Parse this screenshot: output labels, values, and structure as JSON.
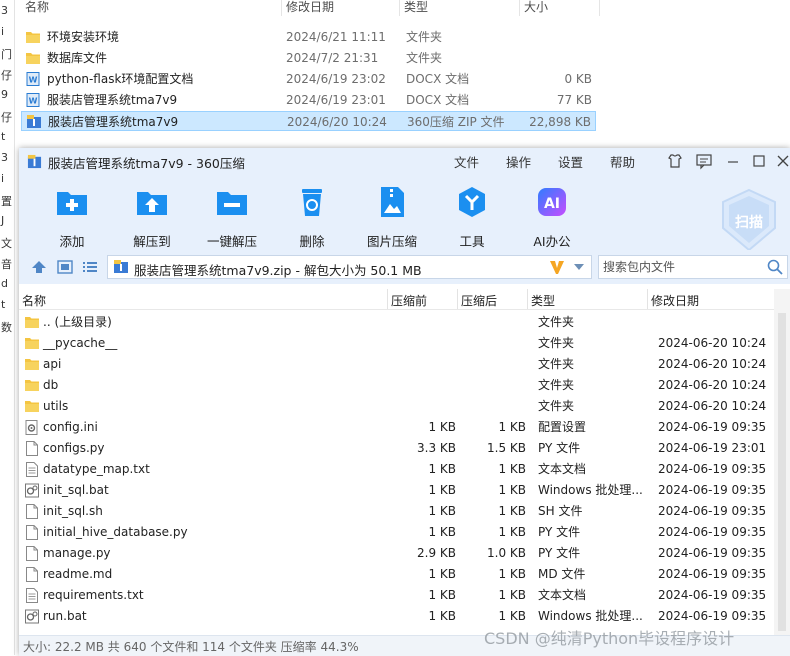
{
  "explorer": {
    "left_fragments": [
      "3",
      "i",
      "门",
      "仔",
      "9",
      "仔",
      "t",
      "3",
      "i",
      "置",
      "J",
      "文",
      "音",
      "d",
      "t",
      "数"
    ],
    "columns": [
      "名称",
      "修改日期",
      "类型",
      "大小"
    ],
    "rows": [
      {
        "name": "环境安装环境",
        "date": "2024/6/21 11:11",
        "type": "文件夹",
        "size": "",
        "icon": "folder-icon",
        "selected": false
      },
      {
        "name": "数据库文件",
        "date": "2024/7/2 21:31",
        "type": "文件夹",
        "size": "",
        "icon": "folder-icon",
        "selected": false
      },
      {
        "name": "python-flask环境配置文档",
        "date": "2024/6/19 23:02",
        "type": "DOCX 文档",
        "size": "0 KB",
        "icon": "word-doc-icon",
        "selected": false
      },
      {
        "name": "服装店管理系统tma7v9",
        "date": "2024/6/19 23:01",
        "type": "DOCX 文档",
        "size": "77 KB",
        "icon": "word-doc-icon",
        "selected": false
      },
      {
        "name": "服装店管理系统tma7v9",
        "date": "2024/6/20 10:24",
        "type": "360压缩 ZIP 文件",
        "size": "22,898 KB",
        "icon": "zip-archive-icon",
        "selected": true
      }
    ]
  },
  "zipwin": {
    "title": "服装店管理系统tma7v9 - 360压缩",
    "menu": [
      "文件",
      "操作",
      "设置",
      "帮助"
    ],
    "tools": [
      {
        "label": "添加",
        "icon": "add-icon"
      },
      {
        "label": "解压到",
        "icon": "extract-to-icon"
      },
      {
        "label": "一键解压",
        "icon": "one-click-extract-icon"
      },
      {
        "label": "删除",
        "icon": "delete-icon"
      },
      {
        "label": "图片压缩",
        "icon": "image-compress-icon"
      },
      {
        "label": "工具",
        "icon": "tools-icon"
      },
      {
        "label": "AI办公",
        "icon": "ai-office-icon"
      }
    ],
    "scan_label": "扫描",
    "ai_badge": "AI",
    "address": "服装店管理系统tma7v9.zip - 解包大小为 50.1 MB",
    "search_placeholder": "搜索包内文件",
    "columns": [
      "名称",
      "压缩前",
      "压缩后",
      "类型",
      "修改日期"
    ],
    "files": [
      {
        "name": ".. (上级目录)",
        "before": "",
        "after": "",
        "type": "文件夹",
        "date": "",
        "icon": "folder-icon"
      },
      {
        "name": "__pycache__",
        "before": "",
        "after": "",
        "type": "文件夹",
        "date": "2024-06-20 10:24",
        "icon": "folder-icon"
      },
      {
        "name": "api",
        "before": "",
        "after": "",
        "type": "文件夹",
        "date": "2024-06-20 10:24",
        "icon": "folder-icon"
      },
      {
        "name": "db",
        "before": "",
        "after": "",
        "type": "文件夹",
        "date": "2024-06-20 10:24",
        "icon": "folder-icon"
      },
      {
        "name": "utils",
        "before": "",
        "after": "",
        "type": "文件夹",
        "date": "2024-06-20 10:24",
        "icon": "folder-icon"
      },
      {
        "name": "config.ini",
        "before": "1 KB",
        "after": "1 KB",
        "type": "配置设置",
        "date": "2024-06-19 09:35",
        "icon": "config-file-icon"
      },
      {
        "name": "configs.py",
        "before": "3.3 KB",
        "after": "1.5 KB",
        "type": "PY 文件",
        "date": "2024-06-19 23:01",
        "icon": "file-icon"
      },
      {
        "name": "datatype_map.txt",
        "before": "1 KB",
        "after": "1 KB",
        "type": "文本文档",
        "date": "2024-06-19 09:35",
        "icon": "text-file-icon"
      },
      {
        "name": "init_sql.bat",
        "before": "1 KB",
        "after": "1 KB",
        "type": "Windows 批处理...",
        "date": "2024-06-19 09:35",
        "icon": "batch-file-icon"
      },
      {
        "name": "init_sql.sh",
        "before": "1 KB",
        "after": "1 KB",
        "type": "SH 文件",
        "date": "2024-06-19 09:35",
        "icon": "file-icon"
      },
      {
        "name": "initial_hive_database.py",
        "before": "1 KB",
        "after": "1 KB",
        "type": "PY 文件",
        "date": "2024-06-19 09:35",
        "icon": "file-icon"
      },
      {
        "name": "manage.py",
        "before": "2.9 KB",
        "after": "1.0 KB",
        "type": "PY 文件",
        "date": "2024-06-19 09:35",
        "icon": "file-icon"
      },
      {
        "name": "readme.md",
        "before": "1 KB",
        "after": "1 KB",
        "type": "MD 文件",
        "date": "2024-06-19 09:35",
        "icon": "file-icon"
      },
      {
        "name": "requirements.txt",
        "before": "1 KB",
        "after": "1 KB",
        "type": "文本文档",
        "date": "2024-06-19 09:35",
        "icon": "text-file-icon"
      },
      {
        "name": "run.bat",
        "before": "1 KB",
        "after": "1 KB",
        "type": "Windows 批处理...",
        "date": "2024-06-19 09:35",
        "icon": "batch-file-icon"
      }
    ],
    "status": "大小: 22.2 MB 共 640 个文件和 114 个文件夹 压缩率 44.3%"
  },
  "watermark": "CSDN @纯清Python毕设程序设计",
  "colors": {
    "accent": "#1b8ff0",
    "window_bg": "#e7f0fc",
    "folder": "#f4c542",
    "selected": "#cce8ff"
  }
}
